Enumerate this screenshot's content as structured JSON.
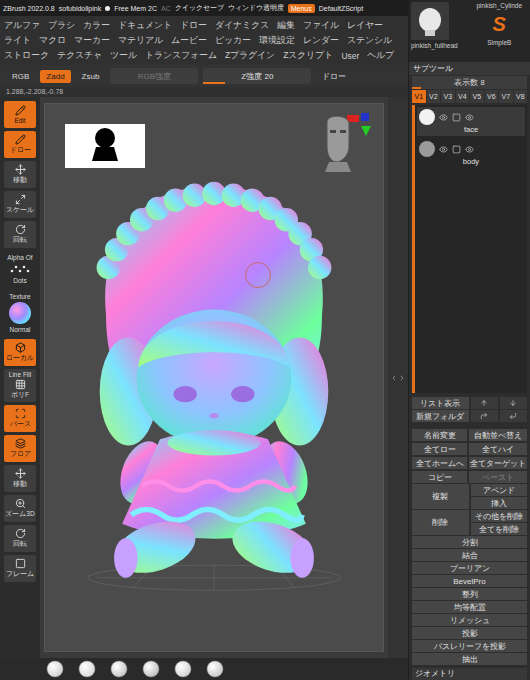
{
  "title_bar": {
    "app": "ZBrush 2022.0.8",
    "file": "sofubidollpink",
    "memory": "Free Mem 2C",
    "memory_extra": "AC",
    "items": [
      "クイックセーブ",
      "ウィンドウ透明度"
    ],
    "menus": {
      "label": "Menus",
      "selected": true
    },
    "script": "DefaultZScript"
  },
  "menu_rows": [
    [
      "アルファ",
      "ブラシ",
      "カラー",
      "ドキュメント",
      "ドロー",
      "ダイナミクス",
      "編集",
      "ファイル",
      "レイヤー"
    ],
    [
      "ライト",
      "マクロ",
      "マーカー",
      "マテリアル",
      "ムービー",
      "ピッカー",
      "環境設定",
      "レンダー",
      "ステンシル"
    ],
    [
      "ストローク",
      "テクスチャ",
      "ツール",
      "トランスフォーム",
      "Zプラグイン",
      "Zスクリプト",
      "User",
      "ヘルプ"
    ]
  ],
  "toolbar": {
    "modes": [
      {
        "label": "RGB",
        "selected": false
      },
      {
        "label": "Zadd",
        "selected": true
      },
      {
        "label": "Zsub",
        "selected": false
      }
    ],
    "sliders": [
      {
        "label": "RGB強度",
        "level": 0,
        "disabled": true
      },
      {
        "label": "Z強度 20",
        "level": 0.2,
        "disabled": false
      }
    ],
    "next": "ドロー"
  },
  "coordinates": "1.288,-2.208,-0.78",
  "left_shelf": {
    "tools": [
      {
        "label": "Edit",
        "selected": true
      },
      {
        "label": "ドロー",
        "selected": true
      },
      {
        "label": "移動",
        "selected": false
      },
      {
        "label": "スケール",
        "selected": false
      },
      {
        "label": "回転",
        "selected": false
      }
    ],
    "alpha": "Alpha Of",
    "stroke": "Dots",
    "texture": "Texture",
    "material": "Normal",
    "view_tools": [
      {
        "label": "ローカル",
        "selected": true
      },
      {
        "label": "ポリF",
        "caption": "Line Fill",
        "selected": false
      },
      {
        "label": "パース",
        "selected": true
      },
      {
        "label": "フロア",
        "selected": true
      },
      {
        "label": "移動",
        "selected": false
      },
      {
        "label": "ズーム3D",
        "selected": false
      },
      {
        "label": "回転",
        "selected": false
      },
      {
        "label": "フレーム",
        "selected": false
      }
    ]
  },
  "thumbnails": [
    {
      "label": "pinkish_fullhead"
    },
    {
      "label": "pinkish_Cylinde"
    },
    {
      "label": "SimpleB",
      "logo": "S"
    }
  ],
  "subtool": {
    "title": "サブツール",
    "display_count": {
      "label": "表示数 8",
      "level": 0.08
    },
    "versions": [
      {
        "label": "V1",
        "selected": true
      },
      {
        "label": "V2",
        "selected": false
      },
      {
        "label": "V3",
        "selected": false
      },
      {
        "label": "V4",
        "selected": false
      },
      {
        "label": "V5",
        "selected": false
      },
      {
        "label": "V6",
        "selected": false
      },
      {
        "label": "V7",
        "selected": false
      },
      {
        "label": "V8",
        "selected": false
      }
    ],
    "items": [
      {
        "name": "face",
        "selected": true,
        "visible": true
      },
      {
        "name": "body",
        "selected": false,
        "visible": true
      }
    ],
    "list_buttons": [
      "リスト表示",
      "新規フォルダ"
    ],
    "buttons": [
      {
        "label": "名前変更",
        "disabled": false
      },
      {
        "label": "自動並べ替え",
        "disabled": false
      },
      {
        "label": "全てロー",
        "disabled": false
      },
      {
        "label": "全てハイ",
        "disabled": false
      },
      {
        "label": "全てホームへ",
        "disabled": false
      },
      {
        "label": "全てターゲット",
        "disabled": false
      },
      {
        "label": "コピー",
        "disabled": false
      },
      {
        "label": "ペースト",
        "disabled": true
      }
    ],
    "groups": [
      {
        "main": "複製",
        "options": [
          "アペンド",
          "挿入"
        ]
      },
      {
        "main": "削除",
        "options": [
          "その他を削除",
          "全てを削除"
        ]
      }
    ],
    "actions": [
      "分割",
      "結合",
      "ブーリアン",
      "BevelPro",
      "整列",
      "均等配置",
      "リメッシュ",
      "投影",
      "バスレリーフを投影",
      "抽出"
    ],
    "next_section": "ジオメトリ"
  }
}
